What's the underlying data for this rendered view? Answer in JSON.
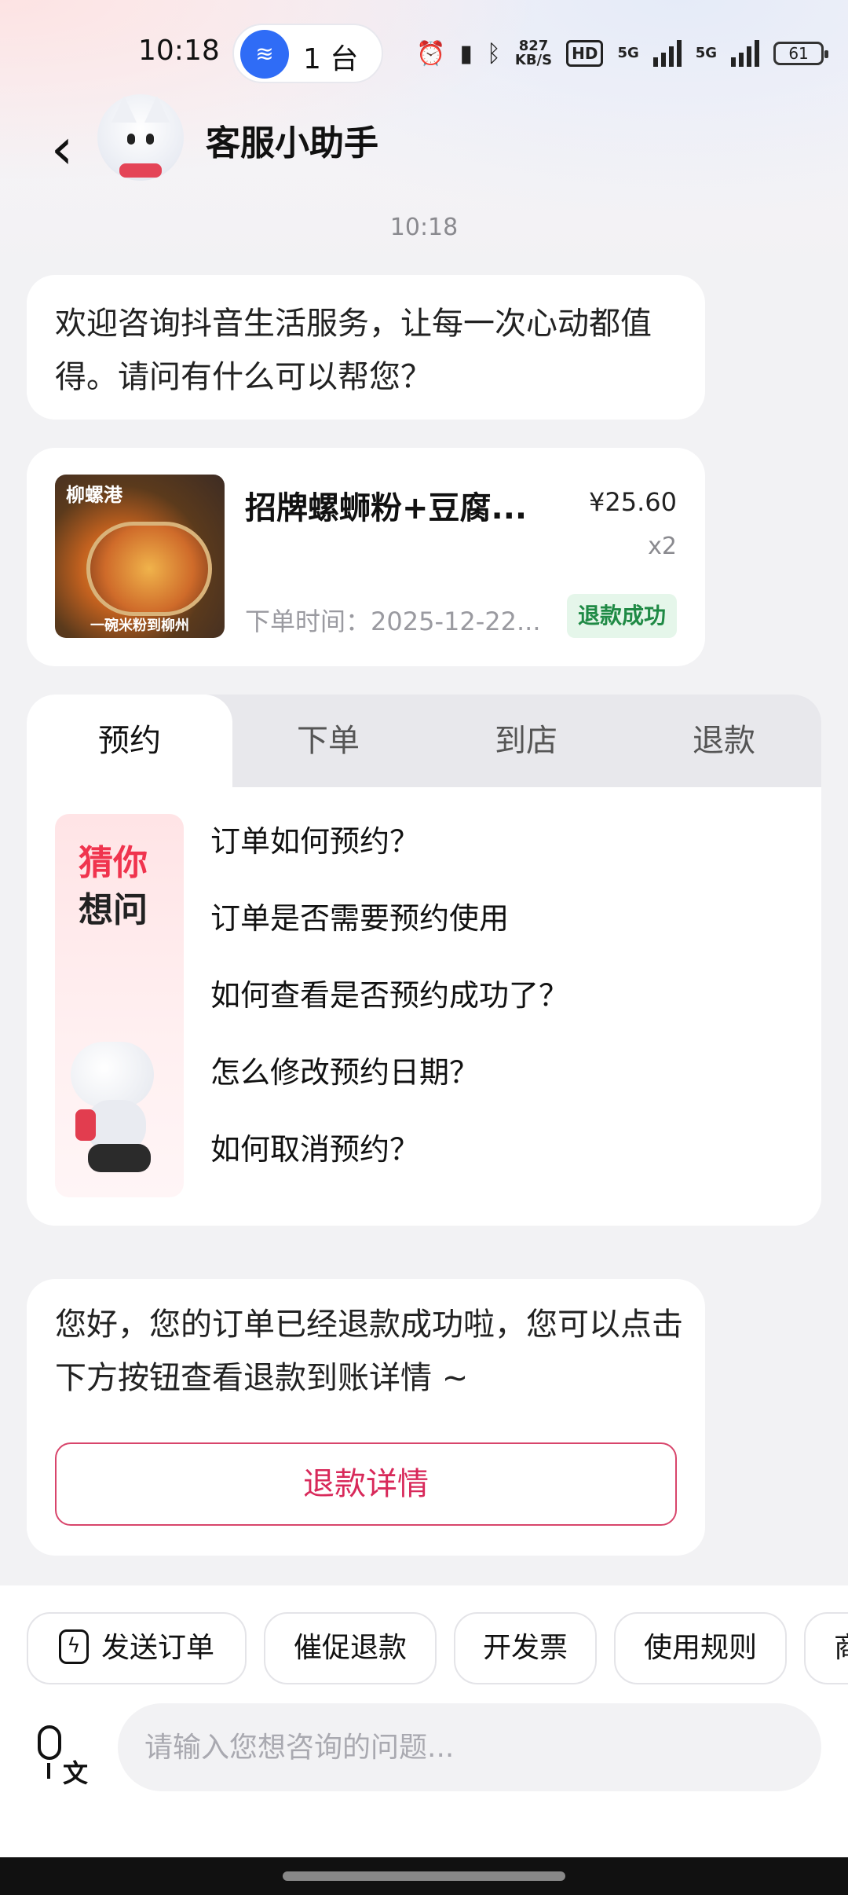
{
  "status_bar": {
    "time": "10:18",
    "hotspot_count": "1 台",
    "net_speed_value": "827",
    "net_speed_unit": "KB/S",
    "hd_label": "HD",
    "signal_1_label": "5G",
    "signal_2_label": "5G",
    "battery": "61",
    "icons": [
      "wifi-hotspot-icon",
      "alarm-icon",
      "vibrate-icon",
      "bluetooth-icon",
      "signal-icon",
      "battery-icon"
    ]
  },
  "header": {
    "title": "客服小助手"
  },
  "chat": {
    "time": "10:18",
    "welcome": "欢迎咨询抖音生活服务，让每一次心动都值得。请问有什么可以帮您？",
    "order": {
      "thumb_brand": "柳螺港",
      "thumb_slogan": "一碗米粉到柳州",
      "name": "招牌螺蛳粉+豆腐...",
      "price": "¥25.60",
      "quantity": "x2",
      "time": "下单时间：2025-12-22...",
      "status": "退款成功"
    },
    "faq": {
      "tabs": [
        {
          "label": "预约"
        },
        {
          "label": "下单"
        },
        {
          "label": "到店"
        },
        {
          "label": "退款"
        }
      ],
      "guess_line1": "猜你",
      "guess_line2": "想问",
      "questions": [
        "订单如何预约？",
        "订单是否需要预约使用",
        "如何查看是否预约成功了？",
        "怎么修改预约日期？",
        "如何取消预约？"
      ]
    },
    "refund_message": "您好，您的订单已经退款成功啦，您可以点击下方按钮查看退款到账详情 ~",
    "refund_button": "退款详情"
  },
  "quick_actions": [
    {
      "label": "发送订单"
    },
    {
      "label": "催促退款"
    },
    {
      "label": "开发票"
    },
    {
      "label": "使用规则"
    },
    {
      "label": "商"
    }
  ],
  "input": {
    "placeholder": "请输入您想咨询的问题..."
  },
  "colors": {
    "accent": "#d8295a",
    "success": "#1f8a45",
    "hotspot": "#2f6cf6"
  }
}
